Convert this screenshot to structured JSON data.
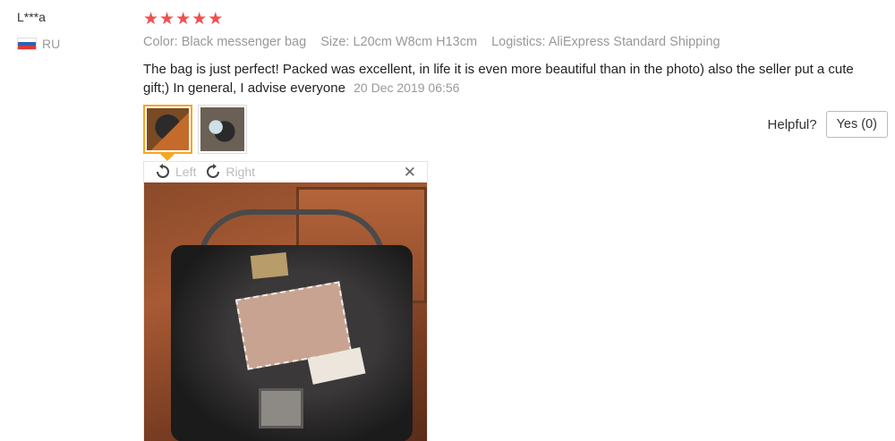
{
  "reviewer": {
    "name": "L***a",
    "country_code": "RU"
  },
  "rating": {
    "stars": 5,
    "color": "#f0504f"
  },
  "attributes": {
    "color": "Color: Black messenger bag",
    "size": "Size: L20cm W8cm H13cm",
    "logistics": "Logistics: AliExpress Standard Shipping"
  },
  "review": {
    "text": "The bag is just perfect! Packed was excellent, in life it is even more beautiful than in the photo) also the seller put a cute gift;) In general, I advise everyone",
    "date": "20 Dec 2019 06:56"
  },
  "helpful": {
    "label": "Helpful?",
    "button_label": "Yes (0)"
  },
  "viewer": {
    "rotate_left": "Left",
    "rotate_right": "Right",
    "close_icon": "close-icon"
  },
  "colors": {
    "accent": "#f5a623",
    "muted": "#999999"
  }
}
